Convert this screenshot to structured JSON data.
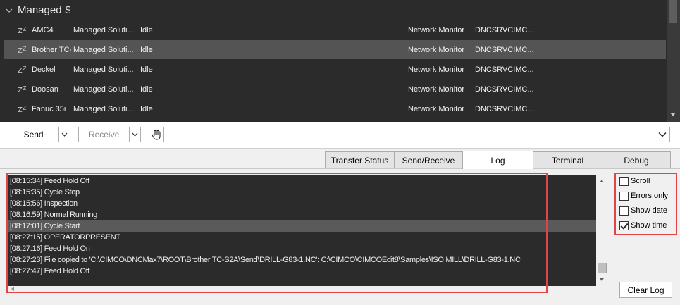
{
  "group": {
    "title": "Managed S"
  },
  "machines": [
    {
      "name": "AMC4",
      "group": "Managed Soluti...",
      "state": "Idle",
      "monitor": "Network Monitor",
      "server": "DNCSRVCIMC..."
    },
    {
      "name": "Brother TC-",
      "group": "Managed Soluti...",
      "state": "Idle",
      "monitor": "Network Monitor",
      "server": "DNCSRVCIMC..."
    },
    {
      "name": "Deckel",
      "group": "Managed Soluti...",
      "state": "Idle",
      "monitor": "Network Monitor",
      "server": "DNCSRVCIMC..."
    },
    {
      "name": "Doosan",
      "group": "Managed Soluti...",
      "state": "Idle",
      "monitor": "Network Monitor",
      "server": "DNCSRVCIMC..."
    },
    {
      "name": "Fanuc 35i",
      "group": "Managed Soluti...",
      "state": "Idle",
      "monitor": "Network Monitor",
      "server": "DNCSRVCIMC..."
    }
  ],
  "toolbar": {
    "send_label": "Send",
    "receive_label": "Receive"
  },
  "tabs": [
    {
      "label": "Transfer Status"
    },
    {
      "label": "Send/Receive"
    },
    {
      "label": "Log"
    },
    {
      "label": "Terminal"
    },
    {
      "label": "Debug"
    }
  ],
  "log": {
    "lines": [
      "[08:15:34] Feed Hold Off",
      "[08:15:35] Cycle Stop",
      "[08:15:56] Inspection",
      "[08:16:59] Normal Running",
      "[08:17:01] Cycle Start",
      "[08:27:15] OPERATORPRESENT",
      "[08:27:16] Feed Hold On",
      "[08:27:47] Feed Hold Off"
    ],
    "copy_line": {
      "prefix": "[08:27:23] File copied to '",
      "src": "C:\\CIMCO\\DNCMax7\\ROOT\\Brother TC-S2A\\Send\\DRILL-G83-1.NC",
      "mid": "': ",
      "dst": "C:\\CIMCO\\CIMCOEdit8\\Samples\\ISO MILL\\DRILL-G83-1.NC"
    }
  },
  "options": {
    "scroll": "Scroll",
    "errors_only": "Errors only",
    "show_date": "Show date",
    "show_time": "Show time"
  },
  "clear_log_label": "Clear Log"
}
